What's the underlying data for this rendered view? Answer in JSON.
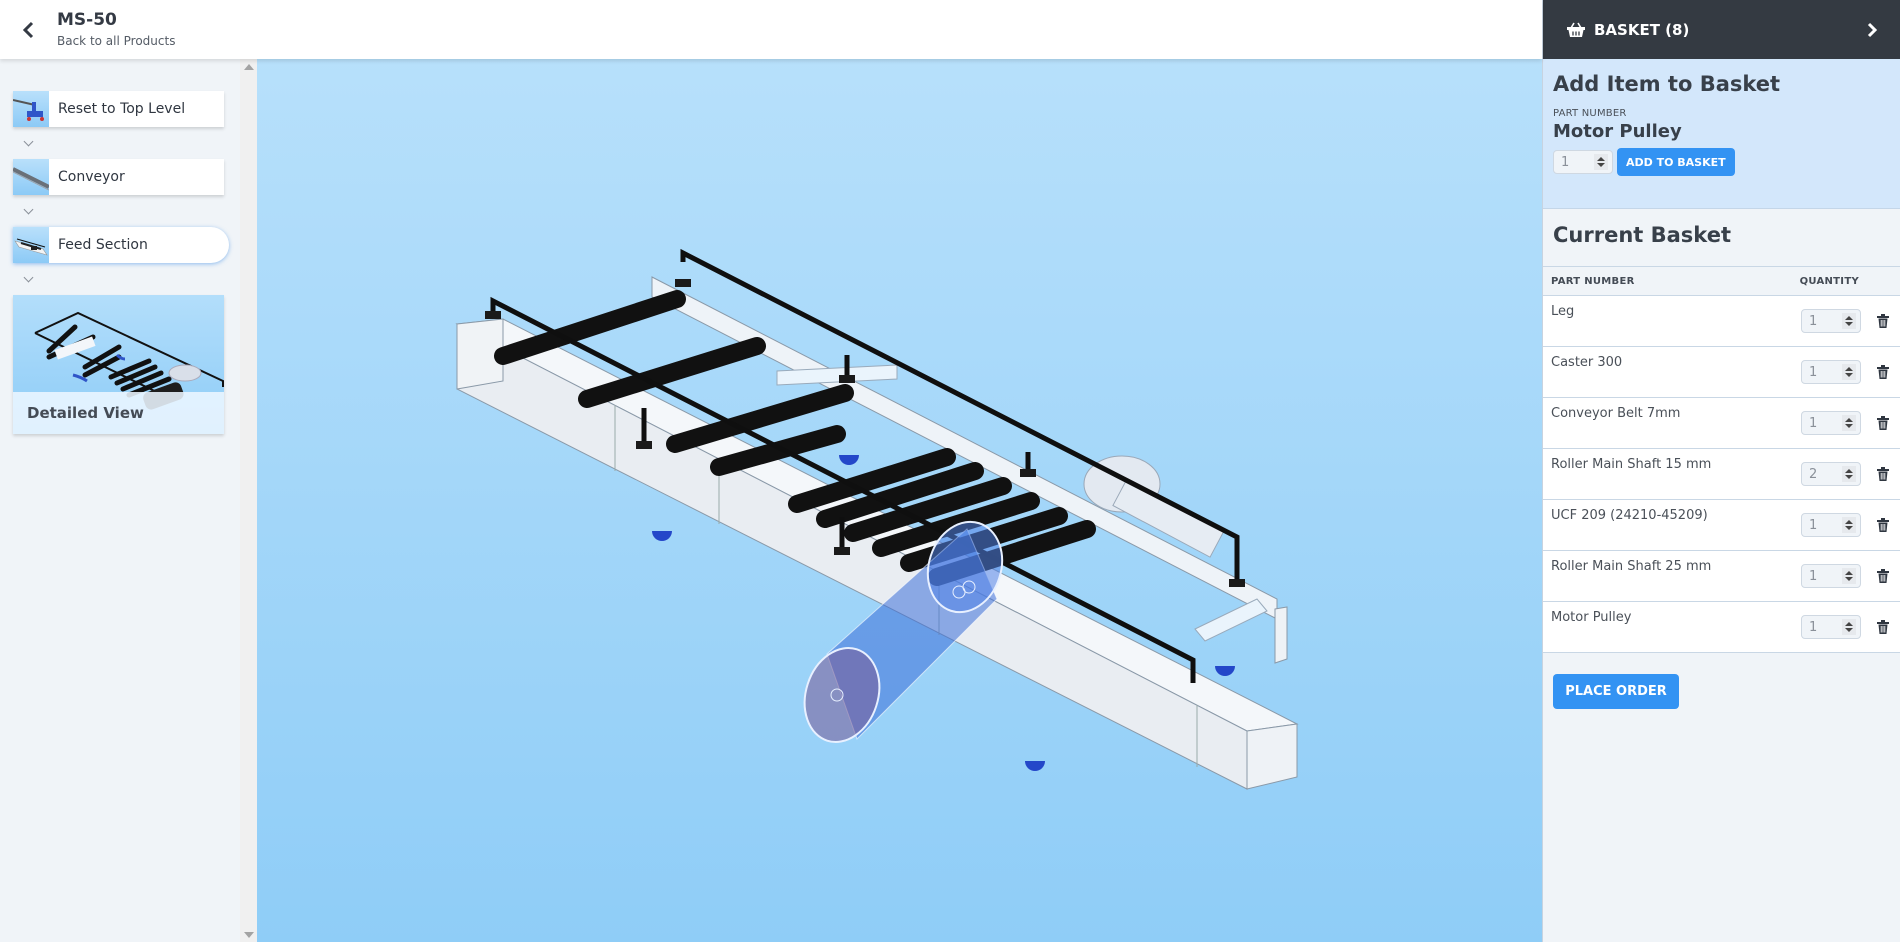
{
  "header": {
    "title": "MS-50",
    "subtitle": "Back to all Products",
    "back_icon": "chevron-left-icon"
  },
  "sidebar": {
    "crumbs": [
      {
        "label": "Reset to Top Level",
        "thumb": "top-level-thumbnail"
      },
      {
        "label": "Conveyor",
        "thumb": "conveyor-thumbnail"
      },
      {
        "label": "Feed Section",
        "thumb": "feed-section-thumbnail",
        "active": true
      }
    ],
    "detail_card": {
      "label": "Detailed View"
    }
  },
  "viewport": {
    "model": "Feed Section 3D assembly (rollers, frame, guard rail, motor pulley highlighted)",
    "highlight_color": "#3d6fd8"
  },
  "basket": {
    "header": "BASKET (8)",
    "count": 8,
    "add_section": {
      "title": "Add Item to Basket",
      "part_number_label": "PART NUMBER",
      "part_name": "Motor Pulley",
      "quantity": "1",
      "add_button": "ADD TO BASKET"
    },
    "current": {
      "title": "Current Basket",
      "columns": [
        "PART NUMBER",
        "QUANTITY"
      ],
      "items": [
        {
          "name": "Leg",
          "qty": "1"
        },
        {
          "name": "Caster 300",
          "qty": "1"
        },
        {
          "name": "Conveyor Belt 7mm",
          "qty": "1"
        },
        {
          "name": "Roller Main Shaft 15 mm",
          "qty": "2"
        },
        {
          "name": "UCF 209 (24210-45209)",
          "qty": "1"
        },
        {
          "name": "Roller Main Shaft 25 mm",
          "qty": "1"
        },
        {
          "name": "Motor Pulley",
          "qty": "1"
        }
      ]
    },
    "place_order": "PLACE ORDER"
  },
  "colors": {
    "accent": "#3393f3",
    "basket_header_bg": "#343a42",
    "add_section_bg": "#d3e7fb",
    "viewport_top": "#b7e0fb",
    "viewport_bottom": "#8fcdf7"
  }
}
